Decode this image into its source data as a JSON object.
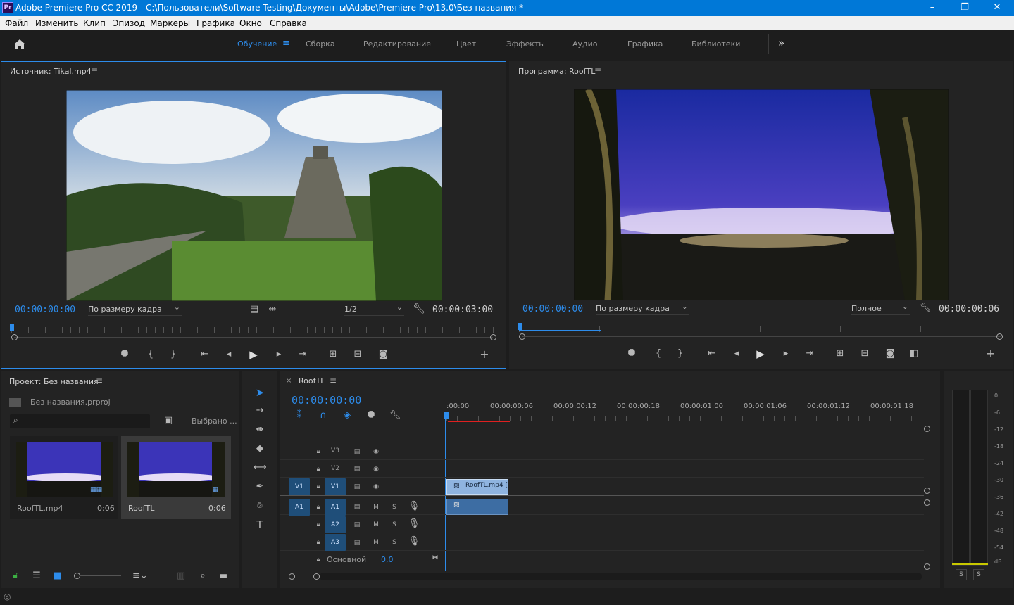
{
  "window": {
    "title": "Adobe Premiere Pro CC 2019 - C:\\Пользователи\\Software Testing\\Документы\\Adobe\\Premiere Pro\\13.0\\Без названия *",
    "app_badge": "Pr",
    "minimize": "–",
    "maximize": "❐",
    "close": "✕"
  },
  "menu": [
    "Файл",
    "Изменить",
    "Клип",
    "Эпизод",
    "Маркеры",
    "Графика",
    "Окно",
    "Справка"
  ],
  "workspaces": {
    "home_icon": "home-icon",
    "items": [
      "Обучение",
      "Сборка",
      "Редактирование",
      "Цвет",
      "Эффекты",
      "Аудио",
      "Графика",
      "Библиотеки"
    ],
    "active": "Обучение",
    "more": "»"
  },
  "source": {
    "title": "Источник: Tikal.mp4",
    "timecode": "00:00:00:00",
    "fit": "По размеру кадра",
    "resolution": "1/2",
    "duration": "00:00:03:00"
  },
  "program": {
    "title": "Программа: RoofTL",
    "timecode": "00:00:00:00",
    "fit": "По размеру кадра",
    "quality": "Полное",
    "duration": "00:00:00:06"
  },
  "project": {
    "title": "Проект: Без названия",
    "file": "Без названия.prproj",
    "search_placeholder": "",
    "selected_label": "Выбрано ...",
    "items": [
      {
        "name": "RoofTL.mp4",
        "duration": "0:06"
      },
      {
        "name": "RoofTL",
        "duration": "0:06"
      }
    ]
  },
  "timeline": {
    "tab": "RoofTL",
    "close": "×",
    "timecode": "00:00:00:00",
    "ruler": [
      ":00:00",
      "00:00:00:06",
      "00:00:00:12",
      "00:00:00:18",
      "00:00:01:00",
      "00:00:01:06",
      "00:00:01:12",
      "00:00:01:18"
    ],
    "video_tracks": [
      "V3",
      "V2",
      "V1"
    ],
    "audio_tracks": [
      "A1",
      "A2",
      "A3"
    ],
    "src_v": "V1",
    "src_a": "A1",
    "master": "Основной",
    "master_value": "0,0",
    "mute": "M",
    "solo": "S",
    "clip_label": "RoofTL.mp4 ["
  },
  "meter": {
    "scale": [
      "0",
      "-6",
      "-12",
      "-18",
      "-24",
      "-30",
      "-36",
      "-42",
      "-48",
      "-54",
      "dB"
    ],
    "solo_left": "S",
    "solo_right": "S"
  },
  "colors": {
    "accent": "#2d8ceb",
    "titlebar": "#0078d7",
    "panel": "#232323",
    "clip_video": "#8fb4e0",
    "clip_audio": "#3d6da3"
  }
}
